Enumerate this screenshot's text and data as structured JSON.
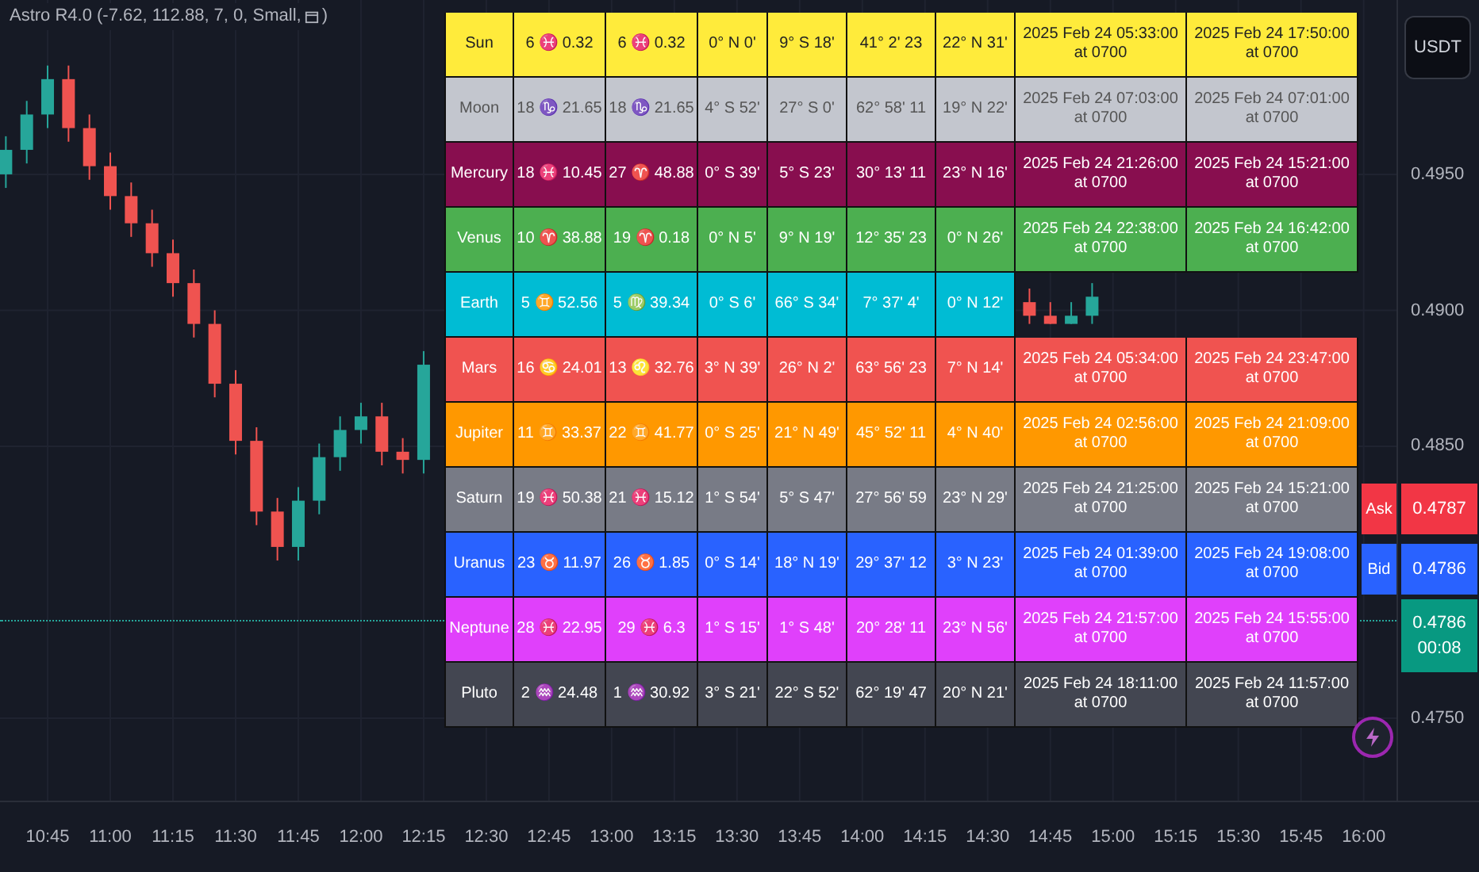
{
  "chart": {
    "chart_data": {
      "type": "candlestick",
      "xlim": [
        633.6,
        987.6
      ],
      "ylim": [
        0.47197,
        0.50141
      ],
      "grid": true,
      "ref_lines": [
        {
          "axis": "y",
          "value": 0.4786
        }
      ],
      "yticks": [
        {
          "value": 0.495,
          "label": "0.4950"
        },
        {
          "value": 0.49,
          "label": "0.4900"
        },
        {
          "value": 0.485,
          "label": "0.4850"
        },
        {
          "value": 0.475,
          "label": "0.4750"
        }
      ],
      "xticks": [
        {
          "value": 645,
          "label": "10:45"
        },
        {
          "value": 660,
          "label": "11:00"
        },
        {
          "value": 675,
          "label": "11:15"
        },
        {
          "value": 690,
          "label": "11:30"
        },
        {
          "value": 705,
          "label": "11:45"
        },
        {
          "value": 720,
          "label": "12:00"
        },
        {
          "value": 735,
          "label": "12:15"
        },
        {
          "value": 750,
          "label": "12:30"
        },
        {
          "value": 765,
          "label": "12:45"
        },
        {
          "value": 780,
          "label": "13:00"
        },
        {
          "value": 795,
          "label": "13:15"
        },
        {
          "value": 810,
          "label": "13:30"
        },
        {
          "value": 825,
          "label": "13:45"
        },
        {
          "value": 840,
          "label": "14:00"
        },
        {
          "value": 855,
          "label": "14:15"
        },
        {
          "value": 870,
          "label": "14:30"
        },
        {
          "value": 885,
          "label": "14:45"
        },
        {
          "value": 900,
          "label": "15:00"
        },
        {
          "value": 915,
          "label": "15:15"
        },
        {
          "value": 930,
          "label": "15:30"
        },
        {
          "value": 945,
          "label": "15:45"
        },
        {
          "value": 960,
          "label": "16:00"
        }
      ],
      "x": [
        635,
        640,
        645,
        650,
        655,
        660,
        665,
        670,
        675,
        680,
        685,
        690,
        695,
        700,
        705,
        710,
        715,
        720,
        725,
        730,
        735,
        880,
        885,
        890,
        895
      ],
      "ohlc": [
        [
          0.495,
          0.4964,
          0.4945,
          0.4959
        ],
        [
          0.4959,
          0.4977,
          0.4954,
          0.4972
        ],
        [
          0.4972,
          0.499,
          0.4967,
          0.4985
        ],
        [
          0.4985,
          0.499,
          0.4962,
          0.4967
        ],
        [
          0.4967,
          0.4972,
          0.4948,
          0.4953
        ],
        [
          0.4953,
          0.4958,
          0.4937,
          0.4942
        ],
        [
          0.4942,
          0.4947,
          0.4927,
          0.4932
        ],
        [
          0.4932,
          0.4937,
          0.4916,
          0.4921
        ],
        [
          0.4921,
          0.4926,
          0.4905,
          0.491
        ],
        [
          0.491,
          0.4915,
          0.489,
          0.4895
        ],
        [
          0.4895,
          0.49,
          0.4868,
          0.4873
        ],
        [
          0.4873,
          0.4878,
          0.4847,
          0.4852
        ],
        [
          0.4852,
          0.4857,
          0.4821,
          0.4826
        ],
        [
          0.4826,
          0.4831,
          0.4808,
          0.4813
        ],
        [
          0.4813,
          0.4835,
          0.4808,
          0.483
        ],
        [
          0.483,
          0.4851,
          0.4825,
          0.4846
        ],
        [
          0.4846,
          0.4861,
          0.4841,
          0.4856
        ],
        [
          0.4856,
          0.4866,
          0.4851,
          0.4861
        ],
        [
          0.4861,
          0.4866,
          0.4843,
          0.4848
        ],
        [
          0.4848,
          0.4853,
          0.484,
          0.4845
        ],
        [
          0.4845,
          0.4885,
          0.484,
          0.488
        ],
        [
          0.4903,
          0.4908,
          0.4895,
          0.4898
        ],
        [
          0.4898,
          0.4903,
          0.4895,
          0.4895
        ],
        [
          0.4895,
          0.4903,
          0.4895,
          0.4898
        ],
        [
          0.4898,
          0.491,
          0.4895,
          0.4905
        ]
      ]
    }
  },
  "indicator": {
    "label": "Astro R4.0 (-7.62, 112.88, 7, 0, Small,",
    "closing": ")"
  },
  "table": {
    "rows": [
      {
        "name": "Sun",
        "color": "#ffeb3b",
        "cells": [
          "6 ♓ 0.32",
          "6 ♓ 0.32",
          "0° N 0'",
          "9° S 18'",
          "41° 2' 23",
          "22° N 31'"
        ],
        "times": [
          "2025 Feb 24 05:33:00 at 0700",
          "2025 Feb 24 17:50:00 at 0700"
        ]
      },
      {
        "name": "Moon",
        "color": "#c3c6ce",
        "cells": [
          "18 ♑ 21.65",
          "18 ♑ 21.65",
          "4° S 52'",
          "27° S 0'",
          "62° 58' 11",
          "19° N 22'"
        ],
        "times": [
          "2025 Feb 24 07:03:00 at 0700",
          "2025 Feb 24 07:01:00 at 0700"
        ]
      },
      {
        "name": "Mercury",
        "color": "#880e4f",
        "cells": [
          "18 ♓ 10.45",
          "27 ♈ 48.88",
          "0° S 39'",
          "5° S 23'",
          "30° 13' 11",
          "23° N 16'"
        ],
        "times": [
          "2025 Feb 24 21:26:00 at 0700",
          "2025 Feb 24 15:21:00 at 0700"
        ]
      },
      {
        "name": "Venus",
        "color": "#4caf50",
        "cells": [
          "10 ♈ 38.88",
          "19 ♈ 0.18",
          "0° N 5'",
          "9° N 19'",
          "12° 35' 23",
          "0° N 26'"
        ],
        "times": [
          "2025 Feb 24 22:38:00 at 0700",
          "2025 Feb 24 16:42:00 at 0700"
        ]
      },
      {
        "name": "Earth",
        "color": "#00bcd4",
        "cells": [
          "5 ♊ 52.56",
          "5 ♍ 39.34",
          "0° S 6'",
          "66° S 34'",
          "7° 37' 4'",
          "0° N 12'"
        ]
      },
      {
        "name": "Mars",
        "color": "#f05350",
        "cells": [
          "16 ♋ 24.01",
          "13 ♌ 32.76",
          "3° N 39'",
          "26° N 2'",
          "63° 56' 23",
          "7° N 14'"
        ],
        "times": [
          "2025 Feb 24 05:34:00 at 0700",
          "2025 Feb 24 23:47:00 at 0700"
        ]
      },
      {
        "name": "Jupiter",
        "color": "#ff9800",
        "cells": [
          "11 ♊ 33.37",
          "22 ♊ 41.77",
          "0° S 25'",
          "21° N 49'",
          "45° 52' 11",
          "4° N 40'"
        ],
        "times": [
          "2025 Feb 24 02:56:00 at 0700",
          "2025 Feb 24 21:09:00 at 0700"
        ]
      },
      {
        "name": "Saturn",
        "color": "#787b86",
        "cells": [
          "19 ♓ 50.38",
          "21 ♓ 15.12",
          "1° S 54'",
          "5° S 47'",
          "27° 56' 59",
          "23° N 29'"
        ],
        "times": [
          "2025 Feb 24 21:25:00 at 0700",
          "2025 Feb 24 15:21:00 at 0700"
        ]
      },
      {
        "name": "Uranus",
        "color": "#2962ff",
        "cells": [
          "23 ♉ 11.97",
          "26 ♉ 1.85",
          "0° S 14'",
          "18° N 19'",
          "29° 37' 12",
          "3° N 23'"
        ],
        "times": [
          "2025 Feb 24 01:39:00 at 0700",
          "2025 Feb 24 19:08:00 at 0700"
        ]
      },
      {
        "name": "Neptune",
        "color": "#e040fb",
        "cells": [
          "28 ♓ 22.95",
          "29 ♓ 6.3",
          "1° S 15'",
          "1° S 48'",
          "20° 28' 11",
          "23° N 56'"
        ],
        "times": [
          "2025 Feb 24 21:57:00 at 0700",
          "2025 Feb 24 15:55:00 at 0700"
        ]
      },
      {
        "name": "Pluto",
        "color": "#434651",
        "cells": [
          "2 ♒ 24.48",
          "1 ♒ 30.92",
          "3° S 21'",
          "22° S 52'",
          "62° 19' 47",
          "20° N 21'"
        ],
        "times": [
          "2025 Feb 24 18:11:00 at 0700",
          "2025 Feb 24 11:57:00 at 0700"
        ]
      }
    ]
  },
  "price_axis": {
    "currency_button": "USDT",
    "quotes": [
      {
        "kind": "ask",
        "label": "Ask",
        "price": "0.4787"
      },
      {
        "kind": "bid",
        "label": "Bid",
        "price": "0.4786"
      }
    ],
    "last": {
      "price": "0.4786",
      "countdown": "00:08"
    }
  }
}
